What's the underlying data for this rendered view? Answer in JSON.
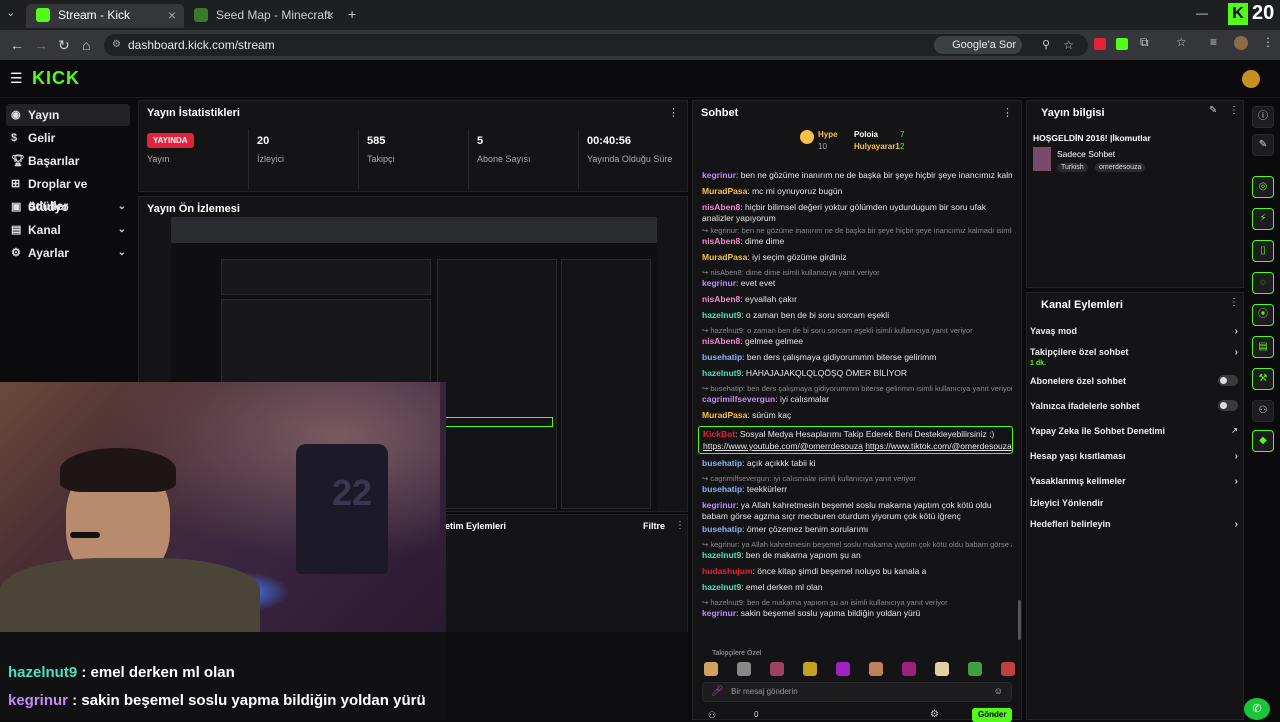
{
  "browser": {
    "tabs": [
      {
        "title": "Stream - Kick Dashboard",
        "active": true
      },
      {
        "title": "Seed Map - Minecraft App",
        "active": false
      }
    ],
    "new_tab": "+",
    "url": "dashboard.kick.com/stream",
    "google_btn": "Google'a Sor",
    "kick_corner_num": "20"
  },
  "kick": {
    "logo": "KICK",
    "accent": "#53fc18"
  },
  "sidebar": {
    "items": [
      {
        "label": "Yayın",
        "selected": true,
        "chevron": ""
      },
      {
        "label": "Gelir",
        "selected": false,
        "chevron": ""
      },
      {
        "label": "Başarılar",
        "selected": false,
        "chevron": ""
      },
      {
        "label": "Droplar ve ödüller",
        "selected": false,
        "chevron": ""
      },
      {
        "label": "Stüdyo",
        "selected": false,
        "chevron": "⌄"
      },
      {
        "label": "Kanal",
        "selected": false,
        "chevron": "⌄"
      },
      {
        "label": "Ayarlar",
        "selected": false,
        "chevron": "⌄"
      }
    ]
  },
  "stats": {
    "title": "Yayın İstatistikleri",
    "live_badge": "YAYINDA",
    "items": [
      {
        "value": "",
        "label": "Yayın"
      },
      {
        "value": "20",
        "label": "İzleyici"
      },
      {
        "value": "585",
        "label": "Takipçi"
      },
      {
        "value": "5",
        "label": "Abone Sayısı"
      },
      {
        "value": "00:40:56",
        "label": "Yayında Olduğu Süre"
      }
    ]
  },
  "preview": {
    "title": "Yayın Ön İzlemesi"
  },
  "actions_panel": {
    "title": "etim Eylemleri",
    "filter": "Filtre"
  },
  "chat": {
    "title": "Sohbet",
    "top": [
      {
        "name": "Hype",
        "count": "10"
      },
      {
        "name": "Poloia",
        "count": "7"
      },
      {
        "name": "Hulyayarar1",
        "count": "2"
      }
    ],
    "messages": [
      {
        "kind": "msg",
        "user": "kegrinur",
        "color": "#c48af7",
        "text": ": ben ne gözüme inanırım ne de başka bir şeye hiçbir şeye inancımız kalmadı"
      },
      {
        "kind": "msg",
        "user": "MuradPasa",
        "color": "#f7c04a",
        "text": ": mc mi oynuyoruz bugün"
      },
      {
        "kind": "msg",
        "user": "nisAben8",
        "color": "#f78ad0",
        "text": ": hiçbir bilimsel değeri yoktur gölümden uydurdugum bir soru ufak analizler yapıyorum"
      },
      {
        "kind": "reply",
        "text": "kegrinur: ben ne gözüme inanırım ne de başka bir şeye hiçbir şeye inancımız kalmadı isimli kulla..."
      },
      {
        "kind": "msg",
        "user": "nisAben8",
        "color": "#f78ad0",
        "text": ": dime dime"
      },
      {
        "kind": "msg",
        "user": "MuradPasa",
        "color": "#f7c04a",
        "text": ": iyi seçim gözüme girdiniz"
      },
      {
        "kind": "reply",
        "text": "nisAben8: dime dime isimli kullanıcıya yanıt veriyor"
      },
      {
        "kind": "msg",
        "user": "kegrinur",
        "color": "#c48af7",
        "text": ": evet evet"
      },
      {
        "kind": "msg",
        "user": "nisAben8",
        "color": "#f78ad0",
        "text": ": eyvallah çakır"
      },
      {
        "kind": "msg",
        "user": "hazelnut9",
        "color": "#4ae0c0",
        "text": ": o zaman ben de bi soru sorcam eşekli"
      },
      {
        "kind": "reply",
        "text": "hazelnut9: o zaman ben de bi soru sorcam eşekli isimli kullanıcıya yanıt veriyor"
      },
      {
        "kind": "msg",
        "user": "nisAben8",
        "color": "#f78ad0",
        "text": ": gelmee gelmee"
      },
      {
        "kind": "msg",
        "user": "busehatip",
        "color": "#8ab4f7",
        "text": ": ben ders çalışmaya gidiyorummm biterse gelirimm"
      },
      {
        "kind": "msg",
        "user": "hazelnut9",
        "color": "#4ae0c0",
        "text": ": HAHAJAJAKQLQLQÖŞQ ÖMER BİLİYOR"
      },
      {
        "kind": "reply",
        "text": "busehatip: ben ders çalışmaya gidiyorummm biterse gelirimm isimli kullanıcıya yanıt veriyor"
      },
      {
        "kind": "msg",
        "user": "cagrimilfsevergun",
        "color": "#c48af7",
        "text": ": iyi calısmalar"
      },
      {
        "kind": "msg",
        "user": "MuradPasa",
        "color": "#f7c04a",
        "text": ": sürüm kaç"
      },
      {
        "kind": "pinned",
        "user": "KickBot",
        "color": "#e5213b",
        "text": ": Sosyal Medya Hesaplarımı Takip Ederek Beni Destekleyebilirsiniz :)",
        "link1": "https://www.youtube.com/@omerrdesouza",
        "link2": "https://www.tiktok.com/@omerdesouza"
      },
      {
        "kind": "msg",
        "user": "busehatip",
        "color": "#8ab4f7",
        "text": ": açık açıkkk tabii ki"
      },
      {
        "kind": "reply",
        "text": "cagrimilfsevergun: iyi calısmalar isimli kullanıcıya yanıt veriyor"
      },
      {
        "kind": "msg",
        "user": "busehatip",
        "color": "#8ab4f7",
        "text": ": teekkürlerr"
      },
      {
        "kind": "msg",
        "user": "kegrinur",
        "color": "#c48af7",
        "text": ": ya Allah kahretmesin beşemel soslu makarna yaptım çok kötü oldu babam görse agzma sıçr mecburen oturdum yiyorum çok kötü iğrenç"
      },
      {
        "kind": "msg",
        "user": "busehatip",
        "color": "#8ab4f7",
        "text": ": ömer çözemez benim sorularımı"
      },
      {
        "kind": "reply",
        "text": "kegrinur: ya Allah kahretmesin beşemel soslu makarna yaptım çok kötü oldu babam görse agz..."
      },
      {
        "kind": "msg",
        "user": "hazelnut9",
        "color": "#4ae0c0",
        "text": ": ben de makarna yapıom şu an"
      },
      {
        "kind": "msg",
        "user": "hudashujum",
        "color": "#e5213b",
        "text": ": önce kitap şimdi beşemel noluyo bu kanala a"
      },
      {
        "kind": "msg",
        "user": "hazelnut9",
        "color": "#4ae0c0",
        "text": ": emel derken ml olan"
      },
      {
        "kind": "reply",
        "text": "hazelnut9: ben de makarna yapıom şu an isimli kullanıcıya yanıt veriyor"
      },
      {
        "kind": "msg",
        "user": "kegrinur",
        "color": "#c48af7",
        "text": ": sakin beşemel soslu yapma bildiğin yoldan yürü"
      }
    ],
    "followers_only_label": "Takipçilere Özel",
    "input_placeholder": "Bir mesaj gönderin",
    "send_label": "Gönder",
    "viewer_count": "0"
  },
  "stream_info": {
    "title": "Yayın bilgisi",
    "stream_title": "HOŞGELDİN 2016! |İkomutlar",
    "category": "Sadece Sohbet",
    "tags": [
      "Turkish",
      "omerdesouza"
    ]
  },
  "channel_actions": {
    "title": "Kanal Eylemleri",
    "items": [
      {
        "label": "Yavaş mod",
        "control": "chevron",
        "sub": ""
      },
      {
        "label": "Takipçilere özel sohbet",
        "control": "chevron",
        "sub": "1 dk."
      },
      {
        "label": "Abonelere özel sohbet",
        "control": "toggle",
        "sub": ""
      },
      {
        "label": "Yalnızca ifadelerle sohbet",
        "control": "toggle",
        "sub": ""
      },
      {
        "label": "Yapay Zeka ile Sohbet Denetimi",
        "control": "external",
        "sub": ""
      },
      {
        "label": "Hesap yaşı kısıtlaması",
        "control": "chevron",
        "sub": ""
      },
      {
        "label": "Yasaklanmış kelimeler",
        "control": "chevron",
        "sub": ""
      },
      {
        "label": "İzleyici Yönlendir",
        "control": "none",
        "sub": ""
      },
      {
        "label": "Hedefleri belirleyin",
        "control": "chevron",
        "sub": ""
      }
    ]
  },
  "overlay_chat": [
    {
      "user": "hazelnut9",
      "color": "#4ae0c0",
      "text": " : emel derken ml olan"
    },
    {
      "user": "kegrinur",
      "color": "#c48af7",
      "text": " : sakin beşemel soslu yapma bildiğin yoldan yürü"
    }
  ]
}
